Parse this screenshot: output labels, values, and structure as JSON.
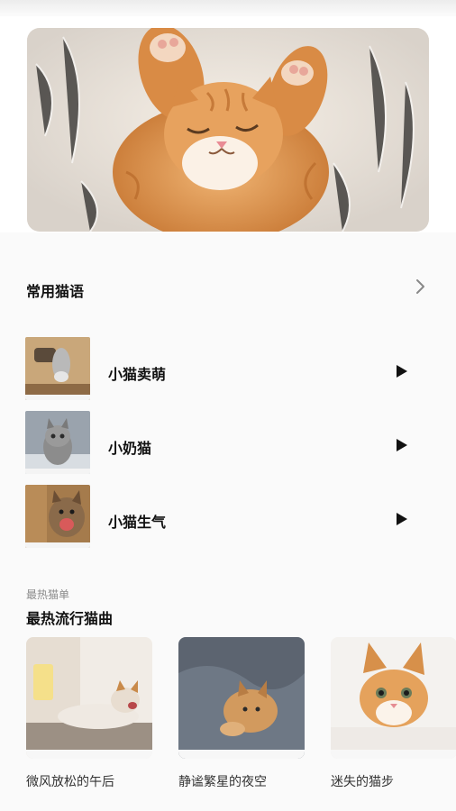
{
  "hero": {
    "image": "sleeping-orange-kitten-photo"
  },
  "common_sounds": {
    "title": "常用猫语",
    "more_icon": "chevron-right-icon",
    "items": [
      {
        "label": "小猫卖萌",
        "thumb": "kitten-paw-from-box-photo",
        "action_icon": "play-icon"
      },
      {
        "label": "小奶猫",
        "thumb": "grey-tabby-kitten-photo",
        "action_icon": "play-icon"
      },
      {
        "label": "小猫生气",
        "thumb": "angry-kitten-in-box-photo",
        "action_icon": "play-icon"
      }
    ]
  },
  "hot_playlists": {
    "caption": "最热猫单",
    "title": "最热流行猫曲",
    "items": [
      {
        "title": "微风放松的午后",
        "cover": "cat-yawning-on-sofa-photo"
      },
      {
        "title": "静谧繁星的夜空",
        "cover": "kitten-on-grey-blanket-photo"
      },
      {
        "title": "迷失的猫步",
        "cover": "orange-kitten-on-white-rug-photo"
      }
    ]
  },
  "colors": {
    "background": "#fafafa",
    "title_text": "#111111",
    "caption_text": "#8a8a8a",
    "cat_orange": "#e49a52"
  }
}
